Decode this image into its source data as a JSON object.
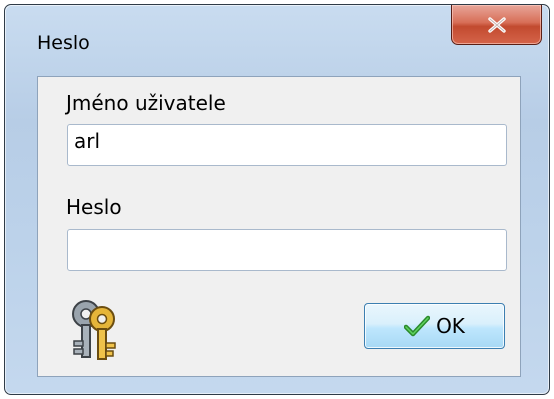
{
  "window": {
    "title": "Heslo",
    "close_icon": "close-x-icon",
    "close_color": "#c24a2f"
  },
  "form": {
    "username_label": "Jméno uživatele",
    "username_value": "arl",
    "password_label": "Heslo",
    "password_value": ""
  },
  "icons": {
    "keys": "keys-icon",
    "ok_check": "checkmark-icon"
  },
  "buttons": {
    "ok_label": "OK"
  }
}
